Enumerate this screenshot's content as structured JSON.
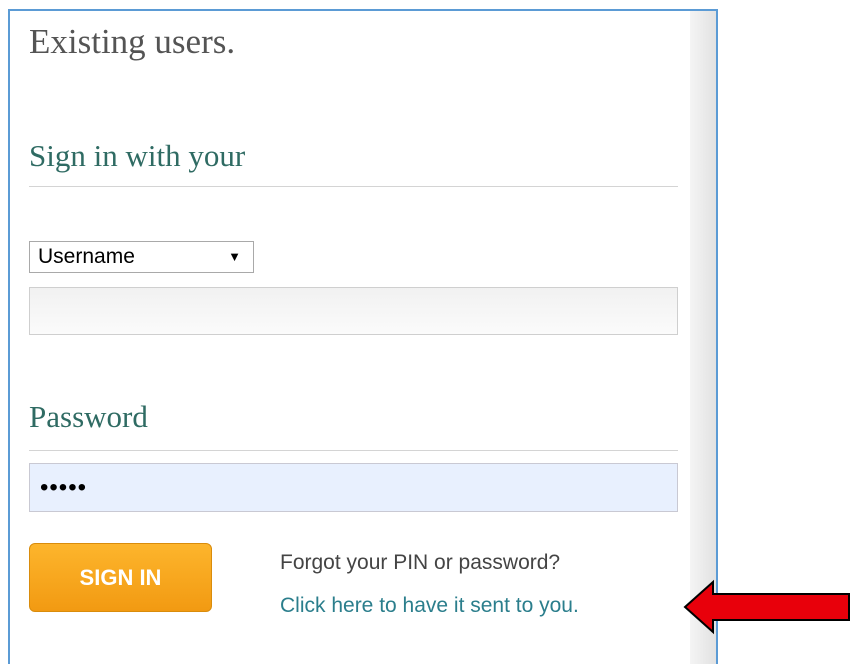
{
  "login": {
    "title": "Existing users.",
    "sign_in_with_label": "Sign in with your",
    "id_type": {
      "selected": "Username",
      "options": [
        "Username"
      ]
    },
    "username_value": "",
    "password_label": "Password",
    "password_value": "•••••",
    "sign_in_button": "SIGN IN",
    "forgot_prompt": "Forgot your PIN or password?",
    "forgot_link": "Click here to have it sent to you."
  },
  "colors": {
    "panel_border": "#5b9bd5",
    "heading_green": "#2f6b63",
    "button_orange": "#f7a51e",
    "link_teal": "#2b7e8c",
    "arrow_red": "#e8000b"
  },
  "icons": {
    "select_caret": "chevron-down-icon",
    "annotation": "red-arrow-icon"
  }
}
